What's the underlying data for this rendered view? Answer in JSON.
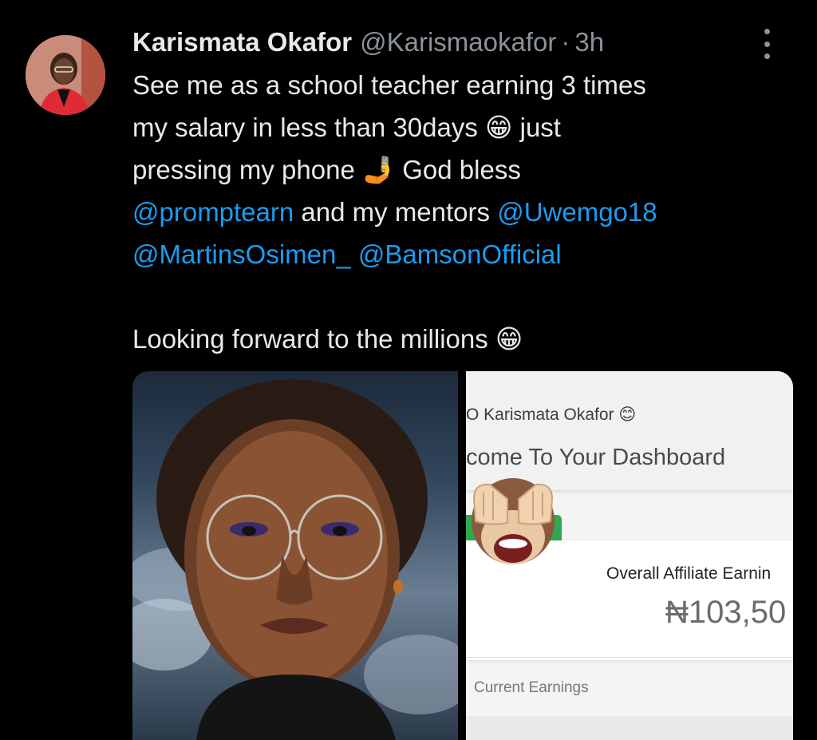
{
  "tweet": {
    "author_name": "Karismata Okafor",
    "author_handle": "@Karismaokafor",
    "separator": "·",
    "time": "3h",
    "more_icon": "more-vertical-icon",
    "line1": "See me as a school teacher earning 3 times",
    "line2_a": "my salary in less than 30days ",
    "line2_emoji": "😁",
    "line2_b": " just",
    "line3_a": "pressing my phone ",
    "line3_emoji": "🤳",
    "line3_b": " God bless",
    "mention1": "@promptearn",
    "line4_mid": " and my mentors ",
    "mention2": "@Uwemgo18",
    "mention3": "@MartinsOsimen_",
    "mention4": "@BamsonOfficial",
    "line6_a": "Looking forward to the millions ",
    "line6_emoji": "😁"
  },
  "dashboard": {
    "greeting": "O Karismata Okafor 😊",
    "welcome": "come To Your Dashboard",
    "earnings_label": "Overall Affiliate Earnin",
    "earnings_value": "₦103,50",
    "current_label": "Current Earnings"
  },
  "colors": {
    "background": "#000000",
    "mention": "#1d9bf0",
    "secondary_text": "#8b9299",
    "green": "#2fa84f"
  }
}
